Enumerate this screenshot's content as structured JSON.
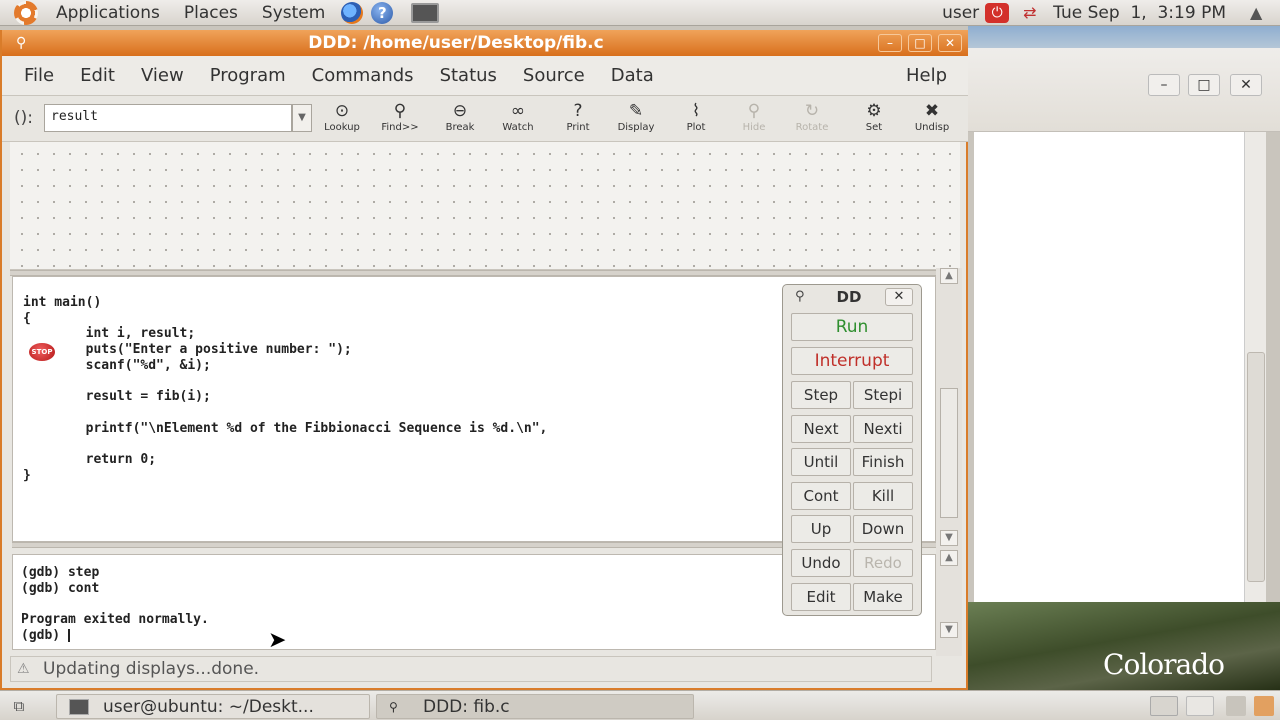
{
  "top_panel": {
    "menus": [
      "Applications",
      "Places",
      "System"
    ],
    "user": "user",
    "clock": "Tue Sep  1,  3:19 PM"
  },
  "ddd": {
    "title": "DDD: /home/user/Desktop/fib.c",
    "menus": [
      "File",
      "Edit",
      "View",
      "Program",
      "Commands",
      "Status",
      "Source",
      "Data"
    ],
    "help_menu": "Help",
    "arg_label": "():",
    "arg_value": "result",
    "toolbar": [
      {
        "label": "Lookup",
        "glyph": "⊙",
        "enabled": true
      },
      {
        "label": "Find>>",
        "glyph": "⚲",
        "enabled": true
      },
      {
        "label": "Break",
        "glyph": "⊖",
        "enabled": true
      },
      {
        "label": "Watch",
        "glyph": "∞",
        "enabled": true
      },
      {
        "label": "Print",
        "glyph": "?",
        "enabled": true
      },
      {
        "label": "Display",
        "glyph": "✎",
        "enabled": true
      },
      {
        "label": "Plot",
        "glyph": "⌇",
        "enabled": true
      },
      {
        "label": "Hide",
        "glyph": "⚲",
        "enabled": false
      },
      {
        "label": "Rotate",
        "glyph": "↻",
        "enabled": false
      },
      {
        "label": "Set",
        "glyph": "⚙",
        "enabled": true
      },
      {
        "label": "Undisp",
        "glyph": "✖",
        "enabled": true
      }
    ],
    "source_lines": [
      "int main()",
      "{",
      "        int i, result;",
      "        puts(\"Enter a positive number: \");",
      "        scanf(\"%d\", &i);",
      "",
      "        result = fib(i);",
      "",
      "        printf(\"\\nElement %d of the Fibbionacci Sequence is %d.\\n\",",
      "",
      "        return 0;",
      "}"
    ],
    "breakpoint_label": "STOP",
    "console_lines": [
      "(gdb) step",
      "(gdb) cont",
      "",
      "Program exited normally.",
      "(gdb) "
    ],
    "status": "Updating displays...done."
  },
  "command_tool": {
    "title": "DD",
    "run": "Run",
    "interrupt": "Interrupt",
    "buttons": [
      [
        "Step",
        "Stepi"
      ],
      [
        "Next",
        "Nexti"
      ],
      [
        "Until",
        "Finish"
      ],
      [
        "Cont",
        "Kill"
      ],
      [
        "Up",
        "Down"
      ],
      [
        "Undo",
        "Redo"
      ],
      [
        "Edit",
        "Make"
      ]
    ]
  },
  "taskbar": {
    "tasks": [
      "user@ubuntu: ~/Deskt...",
      "DDD: fib.c"
    ]
  },
  "wallpaper_text": "Colorado"
}
